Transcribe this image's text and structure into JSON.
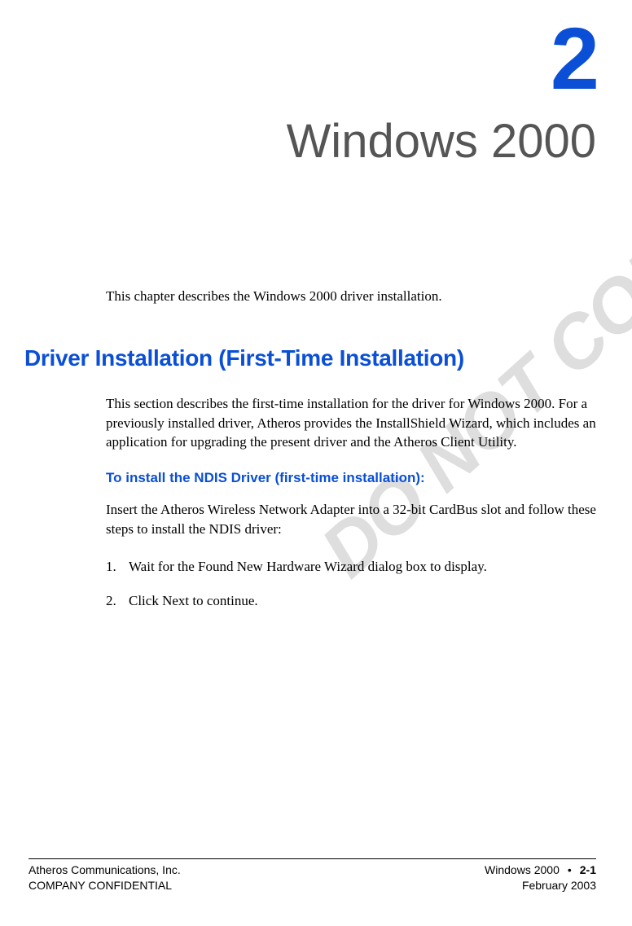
{
  "chapter": {
    "number": "2",
    "title": "Windows 2000"
  },
  "watermark": "DO NOT COPY",
  "intro": "This chapter describes the Windows 2000 driver installation.",
  "section": {
    "heading": "Driver Installation (First-Time Installation)",
    "body": "This section describes the first-time installation for the driver for Windows 2000. For a previously installed driver, Atheros provides the InstallShield Wizard, which includes an application for upgrading the present driver and the Atheros Client Utility.",
    "sub_heading": "To install the NDIS Driver (first-time installation):",
    "instruction": "Insert the Atheros Wireless Network Adapter into a 32-bit CardBus slot and follow these steps to install the NDIS driver:",
    "steps": [
      {
        "num": "1.",
        "text": "Wait for the Found New Hardware Wizard dialog box to display."
      },
      {
        "num": "2.",
        "text": "Click Next to continue."
      }
    ]
  },
  "footer": {
    "left_line1": "Atheros Communications, Inc.",
    "left_line2": "COMPANY CONFIDENTIAL",
    "right_title": "Windows 2000",
    "bullet": "•",
    "page_num": "2-1",
    "right_date": "February 2003"
  }
}
